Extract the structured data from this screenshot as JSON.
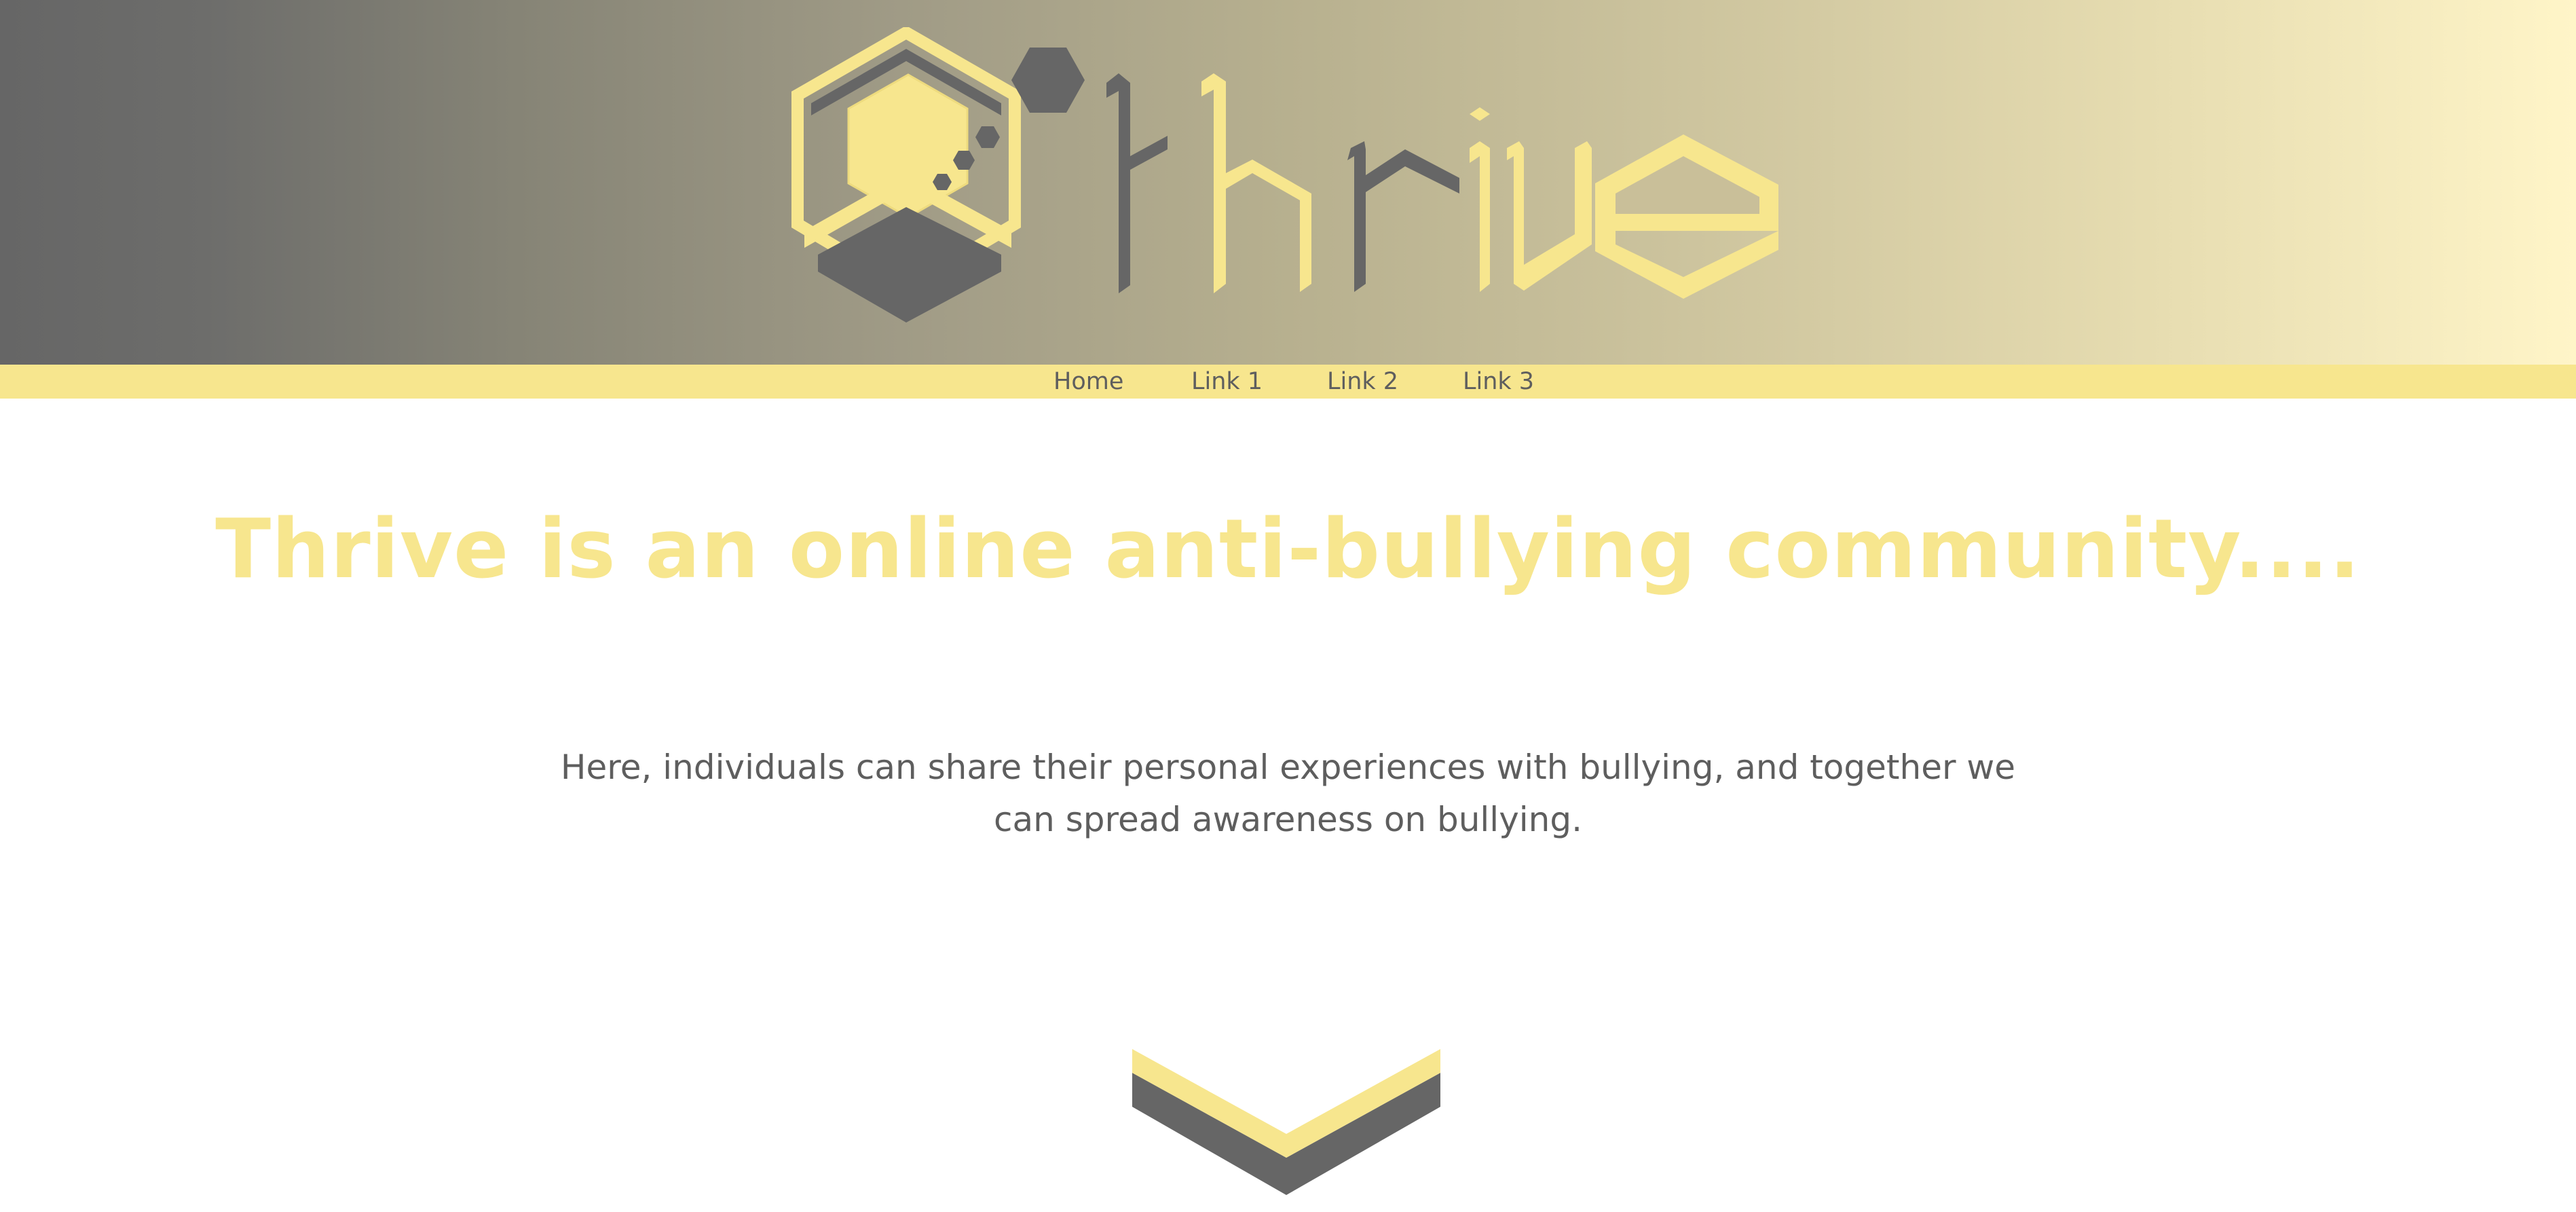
{
  "header": {
    "logo_text": "thrive"
  },
  "nav": {
    "items": [
      {
        "label": "Home"
      },
      {
        "label": "Link 1"
      },
      {
        "label": "Link 2"
      },
      {
        "label": "Link 3"
      }
    ]
  },
  "main": {
    "headline": "Thrive is an online anti-bullying community....",
    "description": "Here, individuals can share their personal experiences with bullying, and together we can spread awareness on bullying."
  },
  "icons": {
    "logo": "hexagon-honeycomb-logo-icon",
    "scroll": "chevron-down-icon"
  },
  "colors": {
    "accent_yellow": "#f7e68e",
    "dark_gray": "#666666",
    "text_gray": "#5e5e5e"
  }
}
